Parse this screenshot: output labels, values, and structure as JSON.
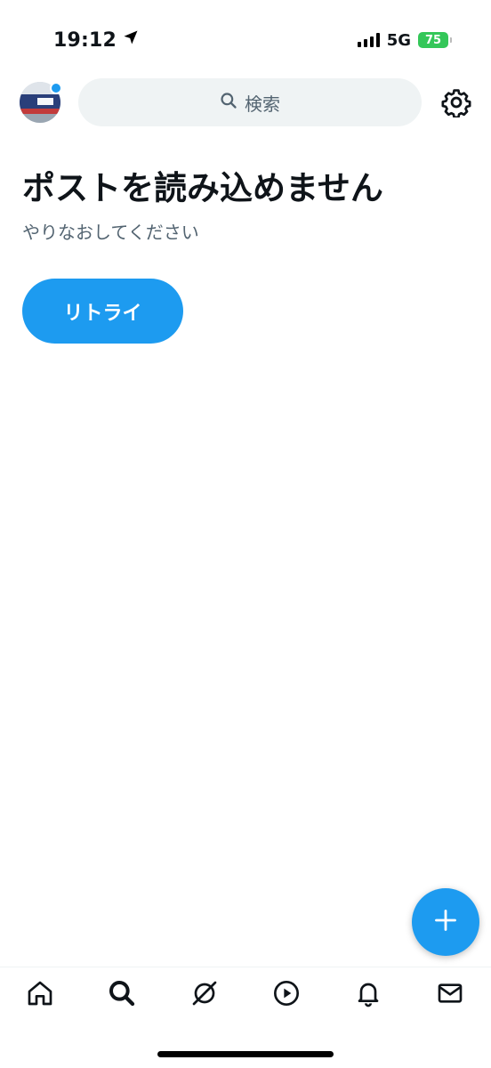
{
  "status_bar": {
    "time": "19:12",
    "network": "5G",
    "battery": "75"
  },
  "header": {
    "search_placeholder": "検索"
  },
  "main": {
    "error_title": "ポストを読み込めません",
    "error_subtitle": "やりなおしてください",
    "retry_label": "リトライ"
  },
  "colors": {
    "accent": "#1d9bf0",
    "text_primary": "#0f1419",
    "text_secondary": "#536471",
    "search_bg": "#eff3f4",
    "battery_green": "#34c759"
  },
  "icons": {
    "header": [
      "avatar",
      "search-icon",
      "gear-icon"
    ],
    "fab": "plus-icon",
    "bottom_nav": [
      "home-icon",
      "search-icon",
      "grok-icon",
      "play-icon",
      "bell-icon",
      "mail-icon"
    ]
  }
}
